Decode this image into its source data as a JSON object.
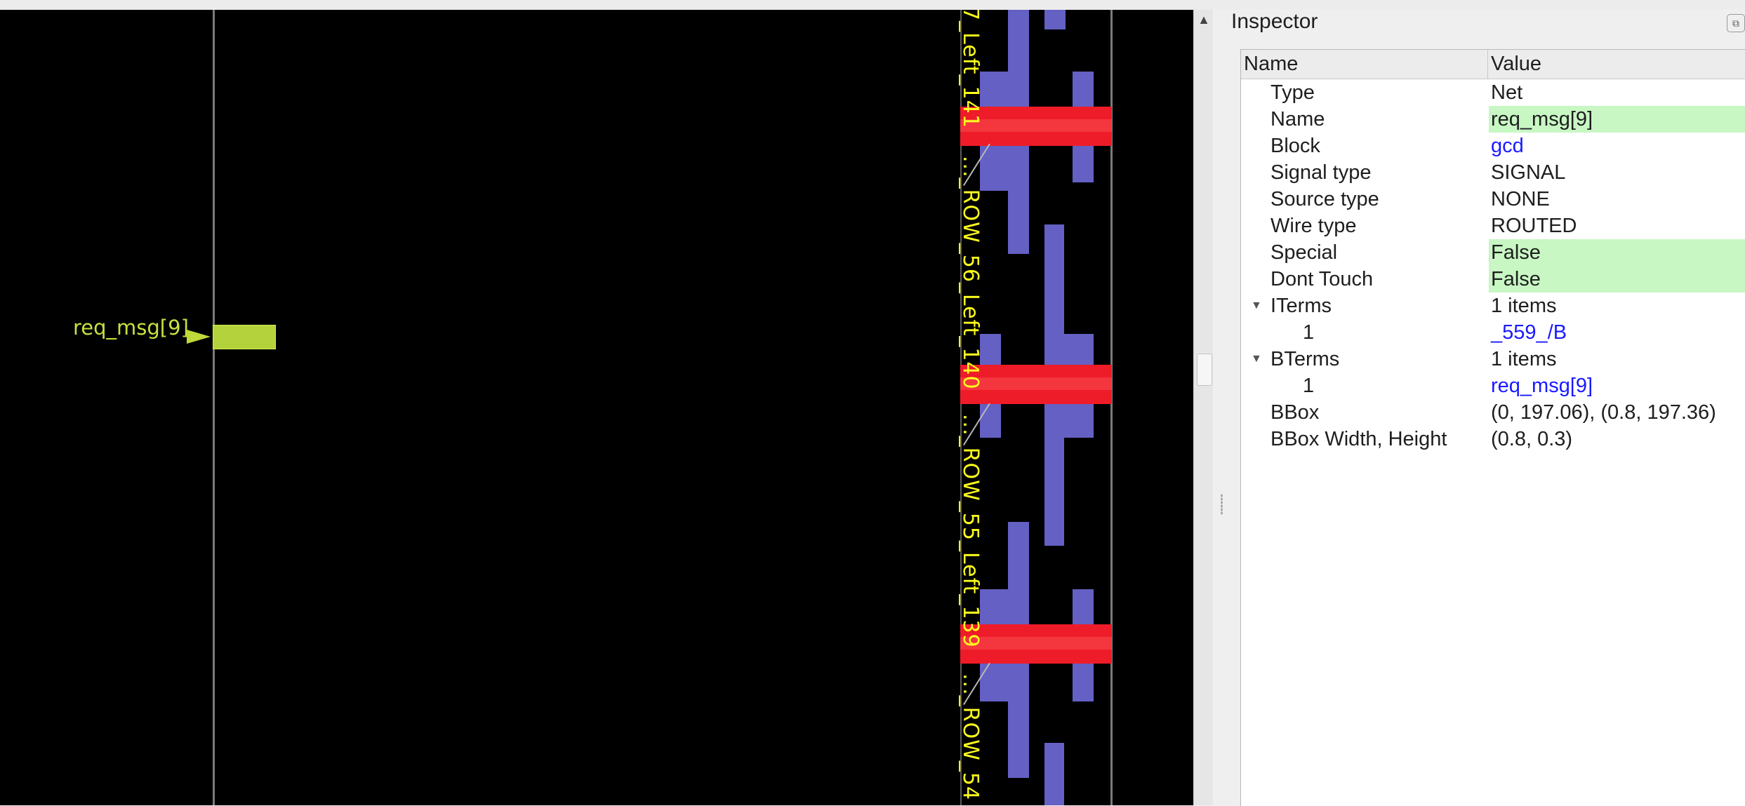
{
  "layout_view": {
    "pin": {
      "label": "req_msg[9]"
    },
    "row_labels": [
      "7_Left_141",
      "..._ROW_56_Left_140",
      "..._ROW_55_Left_139",
      "..._ROW_54"
    ],
    "colors": {
      "background": "#000000",
      "row_label": "#ffff1e",
      "cell_blue": "#6460c4",
      "highlight_red": "#ee1c28",
      "pin": "#b4d23c"
    }
  },
  "inspector": {
    "title": "Inspector",
    "columns": {
      "name": "Name",
      "value": "Value"
    },
    "rows": [
      {
        "name": "Type",
        "value": "Net"
      },
      {
        "name": "Name",
        "value": "req_msg[9]"
      },
      {
        "name": "Block",
        "value": "gcd"
      },
      {
        "name": "Signal type",
        "value": "SIGNAL"
      },
      {
        "name": "Source type",
        "value": "NONE"
      },
      {
        "name": "Wire type",
        "value": "ROUTED"
      },
      {
        "name": "Special",
        "value": "False"
      },
      {
        "name": "Dont Touch",
        "value": "False"
      },
      {
        "name": "ITerms",
        "value": "1 items"
      },
      {
        "name": "1",
        "value": "_559_/B"
      },
      {
        "name": "BTerms",
        "value": "1 items"
      },
      {
        "name": "1",
        "value": "req_msg[9]"
      },
      {
        "name": "BBox",
        "value": "(0, 197.06), (0.8, 197.36)"
      },
      {
        "name": "BBox Width, Height",
        "value": "(0.8, 0.3)"
      }
    ],
    "colors": {
      "highlight": "#c8f7c4",
      "link": "#1a1aff"
    }
  }
}
